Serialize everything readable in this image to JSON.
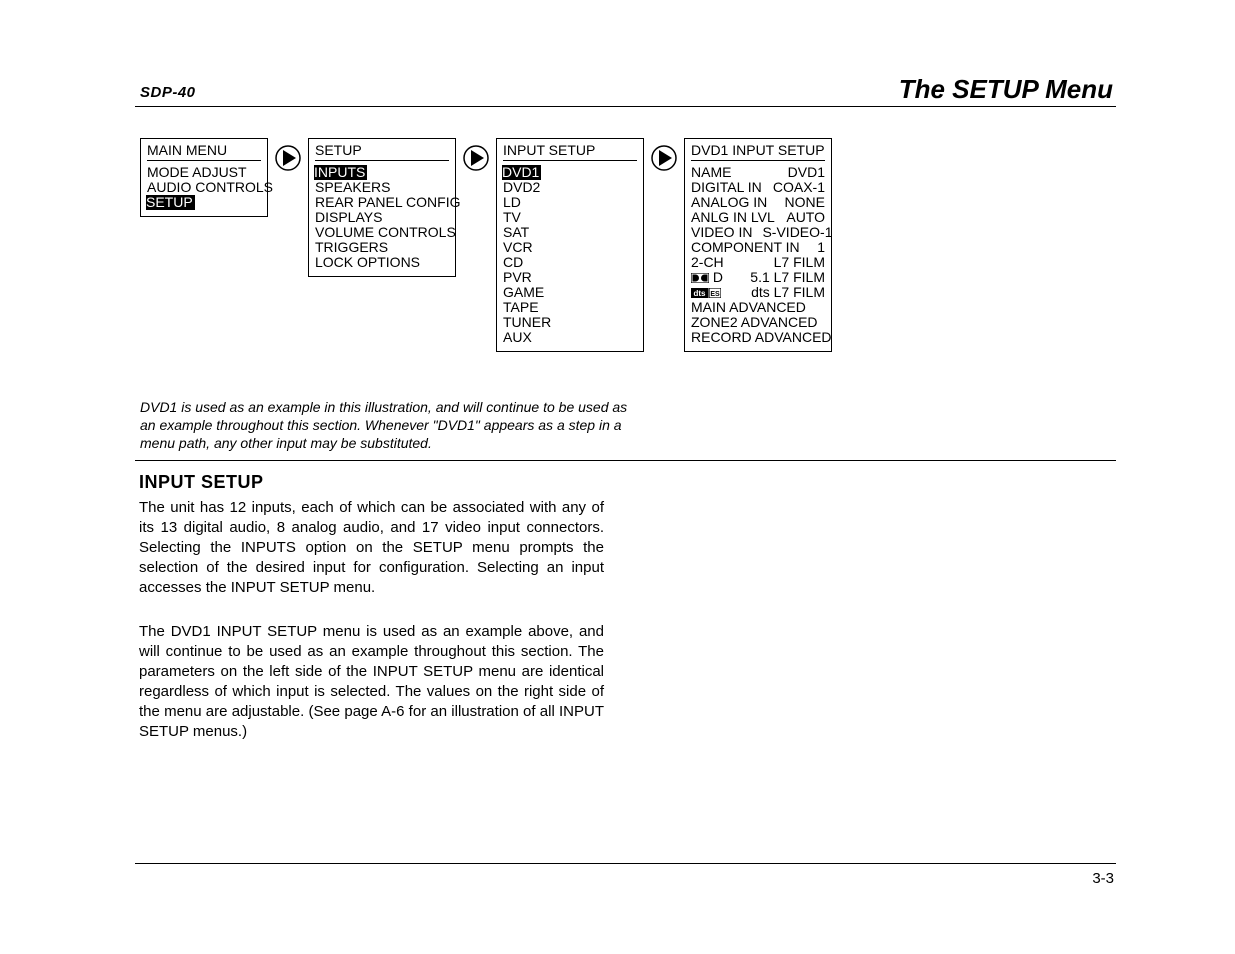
{
  "header": {
    "left": "SDP-40",
    "right": "The SETUP Menu"
  },
  "menus": {
    "main": {
      "title": "MAIN MENU",
      "items": [
        "MODE ADJUST",
        "AUDIO CONTROLS",
        "SETUP"
      ],
      "selected": "SETUP"
    },
    "setup": {
      "title": "SETUP",
      "items": [
        "INPUTS",
        "SPEAKERS",
        "REAR PANEL CONFIG",
        "DISPLAYS",
        "VOLUME CONTROLS",
        "TRIGGERS",
        "LOCK OPTIONS"
      ],
      "selected": "INPUTS"
    },
    "input_setup": {
      "title": "INPUT SETUP",
      "items": [
        "DVD1",
        "DVD2",
        "LD",
        "TV",
        "SAT",
        "VCR",
        "CD",
        "PVR",
        "GAME",
        "TAPE",
        "TUNER",
        "AUX"
      ],
      "selected": "DVD1"
    },
    "dvd1": {
      "title": "DVD1 INPUT SETUP",
      "rows": [
        {
          "k": "NAME",
          "v": "DVD1"
        },
        {
          "k": "DIGITAL IN",
          "v": "COAX-1"
        },
        {
          "k": "ANALOG IN",
          "v": "NONE"
        },
        {
          "k": "ANLG IN LVL",
          "v": "AUTO"
        },
        {
          "k": "VIDEO IN",
          "v": "S-VIDEO-1"
        },
        {
          "k": "COMPONENT IN",
          "v": "1"
        },
        {
          "k": "2-CH",
          "v": "L7 FILM"
        }
      ],
      "dolby_row": {
        "suffix": " D",
        "v": "5.1 L7 FILM"
      },
      "dts_row": {
        "suffix": "",
        "v": "dts L7 FILM"
      },
      "tail": [
        "MAIN ADVANCED",
        "ZONE2 ADVANCED",
        "RECORD ADVANCED"
      ]
    }
  },
  "caption": "DVD1 is used as an example in this illustration, and will continue to be used as an example throughout this section. Whenever \"DVD1\" appears as a step in a menu path, any other input may be substituted.",
  "section": {
    "heading": "INPUT SETUP",
    "p1": "The unit has 12 inputs, each of which can be associated with any of its 13 digital audio, 8 analog audio, and 17 video input connectors.  Selecting the INPUTS option on the SETUP menu prompts the selection of the desired input for configuration. Selecting an input accesses the INPUT SETUP menu.",
    "p2": "The DVD1 INPUT SETUP menu is used as an example above, and will continue to be used as an example throughout this section. The parameters on the left side of the INPUT SETUP menu are identical regardless of which input is selected.  The values on the right side of the menu are adjustable. (See page A-6 for an illustration of all INPUT SETUP menus.)"
  },
  "page_number": "3-3"
}
